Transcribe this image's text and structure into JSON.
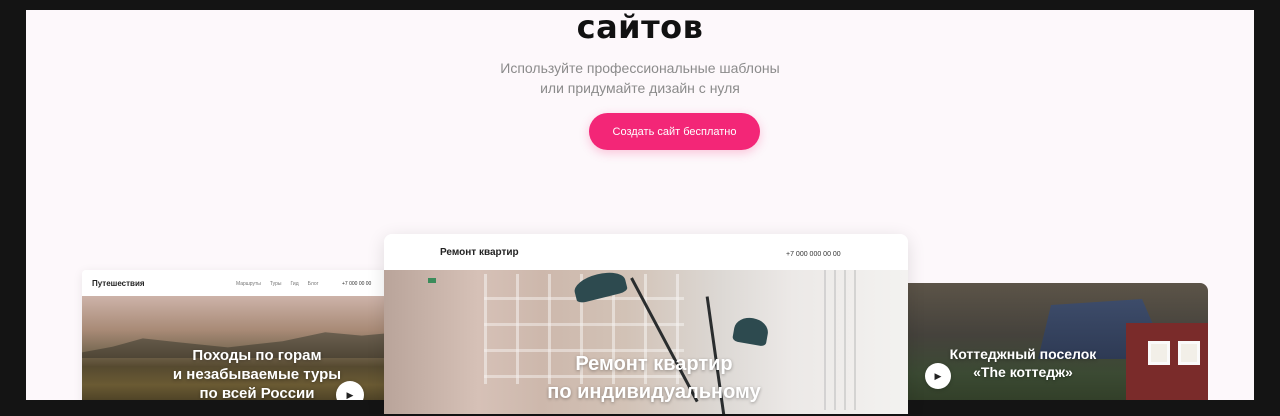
{
  "hero": {
    "headline": "сайтов",
    "subtitle_line1": "Используйте профессиональные шаблоны",
    "subtitle_line2": "или придумайте дизайн с нуля",
    "cta_label": "Создать сайт бесплатно"
  },
  "previews": {
    "left": {
      "logo": "Путешествия",
      "menu": [
        "Маршруты",
        "Туры",
        "Гид",
        "Блог"
      ],
      "phone": "+7 000 00 00",
      "hero_text": "Походы по горам\nи незабываемые туры\nпо всей России",
      "play_icon": "play-icon"
    },
    "center": {
      "logo": "Ремонт квартир",
      "phone": "+7 000 000 00 00",
      "hero_text": "Ремонт квартир\nпо индивидуальному"
    },
    "right": {
      "hero_text": "Коттеджный поселок\n«The коттедж»",
      "play_icon": "play-icon"
    }
  },
  "colors": {
    "page_bg": "#fdf8fb",
    "accent": "#f32677",
    "frame": "#141414"
  }
}
